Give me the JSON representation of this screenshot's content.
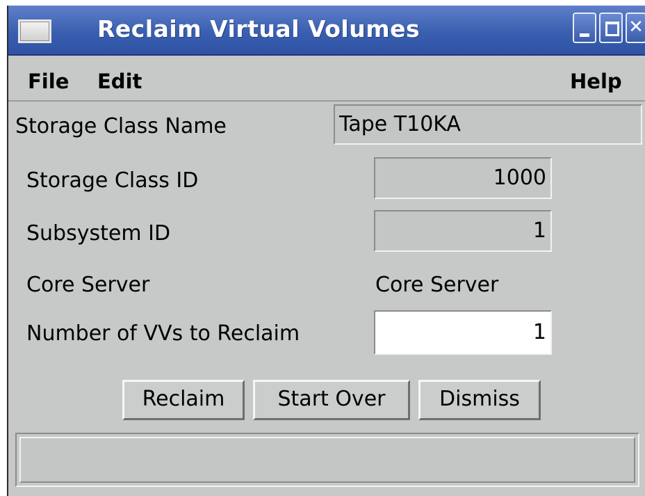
{
  "window": {
    "title": "Reclaim Virtual Volumes",
    "icon": "window-icon",
    "controls": {
      "minimize": "minimize-icon",
      "maximize": "maximize-icon",
      "close_glyph": "✕"
    }
  },
  "menubar": {
    "file": "File",
    "edit": "Edit",
    "help": "Help"
  },
  "form": {
    "storage_class_name": {
      "label": "Storage Class Name",
      "value": "Tape  T10KA"
    },
    "storage_class_id": {
      "label": "Storage Class ID",
      "value": "1000"
    },
    "subsystem_id": {
      "label": "Subsystem ID",
      "value": "1"
    },
    "core_server": {
      "label": "Core Server",
      "value": "Core Server"
    },
    "num_vvs": {
      "label": "Number of VVs to Reclaim",
      "value": "1"
    }
  },
  "buttons": {
    "reclaim": "Reclaim",
    "start_over": "Start Over",
    "dismiss": "Dismiss"
  },
  "status": {
    "message": ""
  },
  "colors": {
    "title_bar": "#3a5fb0",
    "window_bg": "#c7c9c8",
    "field_bg": "#c4c6c5"
  }
}
